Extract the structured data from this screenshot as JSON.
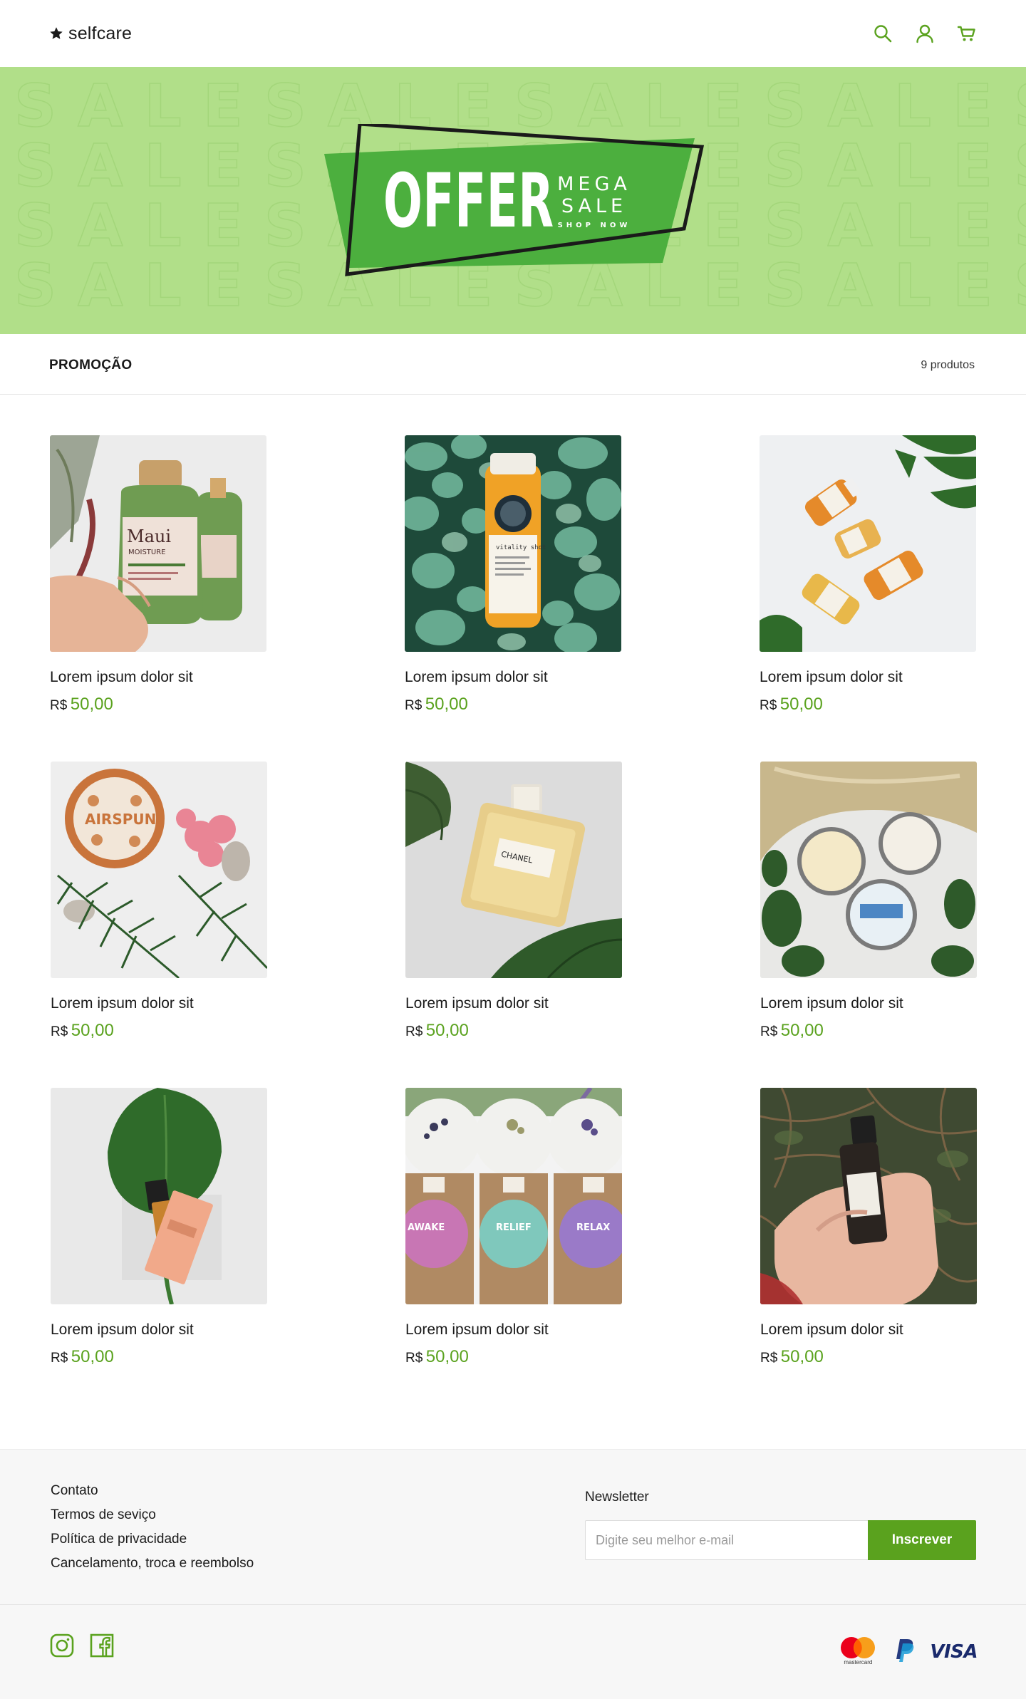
{
  "header": {
    "brand": "selfcare",
    "icons": [
      "star-icon",
      "search-icon",
      "user-icon",
      "cart-icon"
    ]
  },
  "banner": {
    "pattern_word": "SALE",
    "offer": "OFFER",
    "mega": "MEGA",
    "sale": "SALE",
    "shop_now": "SHOP NOW"
  },
  "section": {
    "title": "PROMOÇÃO",
    "count": "9 produtos"
  },
  "products": [
    {
      "name": "Lorem ipsum dolor sit",
      "currency": "R$",
      "price": "50,00"
    },
    {
      "name": "Lorem ipsum dolor sit",
      "currency": "R$",
      "price": "50,00"
    },
    {
      "name": "Lorem ipsum dolor sit",
      "currency": "R$",
      "price": "50,00"
    },
    {
      "name": "Lorem ipsum dolor sit",
      "currency": "R$",
      "price": "50,00"
    },
    {
      "name": "Lorem ipsum dolor sit",
      "currency": "R$",
      "price": "50,00"
    },
    {
      "name": "Lorem ipsum dolor sit",
      "currency": "R$",
      "price": "50,00"
    },
    {
      "name": "Lorem ipsum dolor sit",
      "currency": "R$",
      "price": "50,00"
    },
    {
      "name": "Lorem ipsum dolor sit",
      "currency": "R$",
      "price": "50,00"
    },
    {
      "name": "Lorem ipsum dolor sit",
      "currency": "R$",
      "price": "50,00"
    }
  ],
  "product_images": {
    "p1_label": "Maui",
    "p1_sub": "MOISTURE",
    "p2_label": "vitality shot",
    "p4_label": "AIRSPUN",
    "p5_label": "CHANEL",
    "p8_labels": [
      "AWAKE",
      "RELIEF",
      "RELAX"
    ]
  },
  "footer": {
    "links": [
      "Contato",
      "Termos de seviço",
      "Política de privacidade",
      "Cancelamento, troca e reembolso"
    ],
    "newsletter_label": "Newsletter",
    "newsletter_placeholder": "Digite seu melhor e-mail",
    "newsletter_button": "Inscrever",
    "social": [
      "instagram-icon",
      "facebook-icon"
    ],
    "mastercard_label": "mastercard",
    "visa": "VISA"
  },
  "colors": {
    "accent": "#5aa21e",
    "banner_bg": "#b1df89",
    "offer_green": "#4caf3e",
    "footer_bg": "#f7f7f7"
  }
}
